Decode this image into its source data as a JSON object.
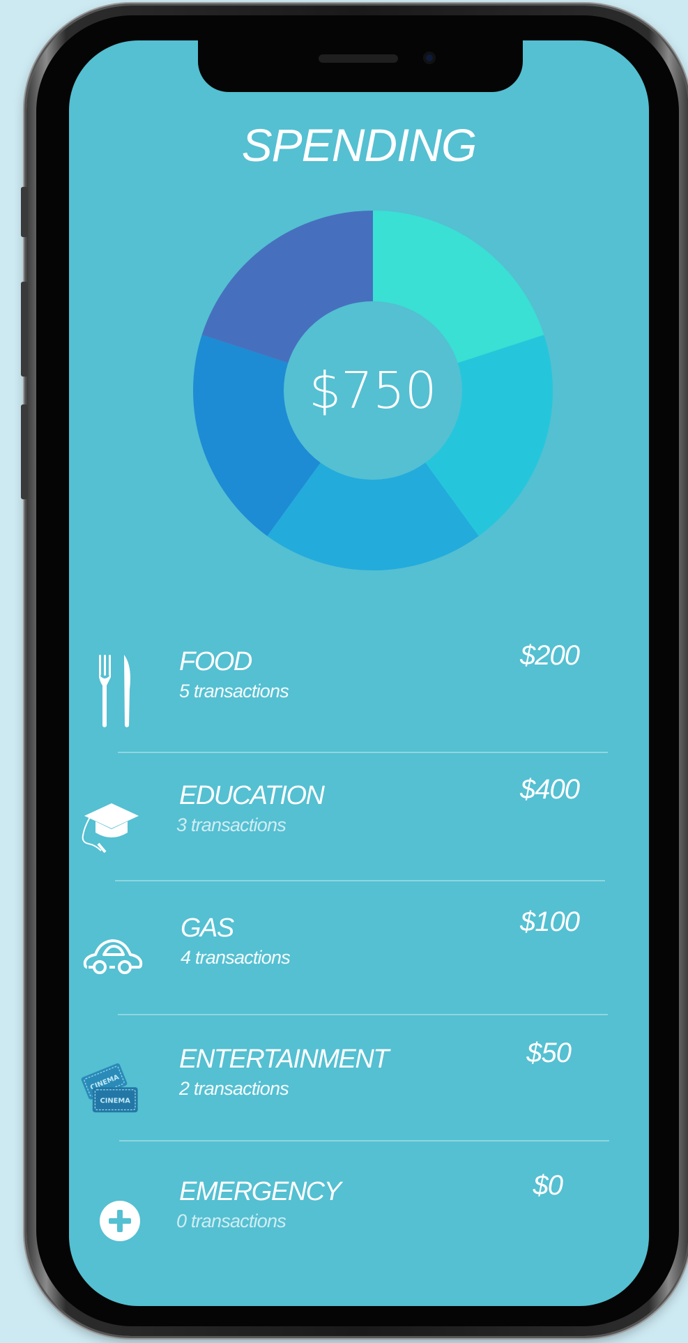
{
  "header": {
    "title": "SPENDING"
  },
  "total": {
    "label": "$750"
  },
  "chart_data": {
    "type": "pie",
    "donut": true,
    "center_label": "$750",
    "slices": [
      {
        "value": 20,
        "color": "#39e0d3"
      },
      {
        "value": 20,
        "color": "#25c6dc"
      },
      {
        "value": 20,
        "color": "#23abdc"
      },
      {
        "value": 20,
        "color": "#1d8cd4"
      },
      {
        "value": 20,
        "color": "#4670be"
      }
    ]
  },
  "categories": [
    {
      "name": "FOOD",
      "transactions": "5 transactions",
      "amount": "$200",
      "icon": "fork-knife-icon"
    },
    {
      "name": "EDUCATION",
      "transactions": "3 transactions",
      "amount": "$400",
      "icon": "graduation-cap-icon"
    },
    {
      "name": "GAS",
      "transactions": "4 transactions",
      "amount": "$100",
      "icon": "car-icon"
    },
    {
      "name": "ENTERTAINMENT",
      "transactions": "2 transactions",
      "amount": "$50",
      "icon": "cinema-tickets-icon"
    },
    {
      "name": "EMERGENCY",
      "transactions": "0 transactions",
      "amount": "$0",
      "icon": "plus-circle-icon"
    }
  ],
  "colors": {
    "screen_background": "#54c0d2",
    "text": "#ffffff",
    "page_background": "#cde9f2"
  }
}
